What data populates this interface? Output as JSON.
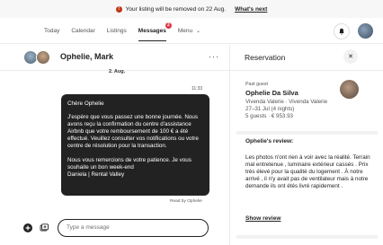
{
  "banner": {
    "message": "Your listing will be removed on 22 Aug.",
    "link": "What's next"
  },
  "nav": {
    "tabs": [
      {
        "label": "Today"
      },
      {
        "label": "Calendar"
      },
      {
        "label": "Listings"
      },
      {
        "label": "Messages",
        "badge": "2",
        "active": true
      },
      {
        "label": "Menu"
      }
    ]
  },
  "chat": {
    "title": "Ophelie, Mark",
    "date": "2. Aug.",
    "time": "11:33",
    "message": {
      "p1": "Chère Ophelie",
      "p2": "J'espère que vous passez une bonne journée. Nous avons reçu la confirmation du centre d'assistance Airbnb que votre remboursement de 100 € a été effectué. Veuillez consulter vos notifications ou votre centre de résolution pour la transaction.",
      "p3": "Nous vous remercions de votre patience. Je vous souhaite un bon week-end",
      "p4": "Daniela | Rental Valley"
    },
    "read_receipt": "Read by Ophelie",
    "composer_placeholder": "Type a message"
  },
  "reservation": {
    "title": "Reservation",
    "past_guest_label": "Past guest",
    "guest_name": "Ophelie Da Silva",
    "listing": "Vivenda Valerie · Vivenda Valerie",
    "dates": "27–31 Jul (4 nights)",
    "summary": "5 guests · € 953.93",
    "review_title": "Ophelie's review:",
    "review_text": "Les photos n'ont rien à voir avec la réalité. Terrain mal entretenue , luminaire extérieur cassés . Prix très élevé pour la qualité du logement . À notre arrivé , il n'y avait pas de ventilateur mais à notre demande ils ont étés livré rapidement .",
    "show_review": "Show review"
  }
}
